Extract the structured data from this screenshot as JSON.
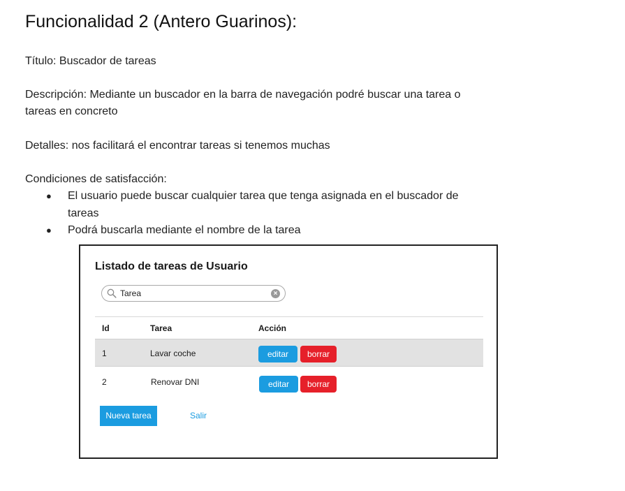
{
  "document": {
    "title": "Funcionalidad 2 (Antero Guarinos):",
    "titulo_line": "Título: Buscador de tareas",
    "descripcion_line1": "Descripción: Mediante un buscador en la barra de navegación podré buscar una tarea o",
    "descripcion_line2": "tareas en concreto",
    "detalles_line": "Detalles: nos facilitará el encontrar tareas si tenemos muchas",
    "condiciones_heading": "Condiciones de satisfacción:",
    "bullet_glyph": "●",
    "bullets": [
      {
        "line1": "El usuario puede buscar cualquier  tarea que tenga asignada en el buscador de",
        "line2": "tareas"
      },
      {
        "line1": "Podrá buscarla mediante el nombre de la tarea"
      }
    ]
  },
  "mockup": {
    "title": "Listado de tareas de Usuario",
    "search": {
      "value": "Tarea",
      "clear_glyph": "×"
    },
    "columns": [
      "Id",
      "Tarea",
      "Acción"
    ],
    "rows": [
      {
        "id": "1",
        "tarea": "Lavar coche",
        "edit_label": "editar",
        "delete_label": "borrar"
      },
      {
        "id": "2",
        "tarea": "Renovar DNI",
        "edit_label": "editar",
        "delete_label": "borrar"
      }
    ],
    "new_button_label": "Nueva tarea",
    "exit_link_label": "Salir"
  },
  "colors": {
    "primary_blue": "#1b9ce0",
    "danger_red": "#e6202a",
    "row_shade": "#e2e2e2"
  }
}
